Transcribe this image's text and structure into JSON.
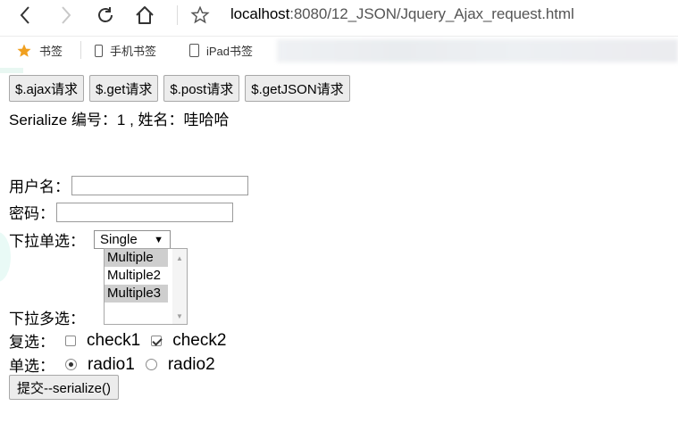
{
  "browser": {
    "url_host": "localhost",
    "url_path": ":8080/12_JSON/Jquery_Ajax_request.html",
    "bookmarks": [
      {
        "label": "书签"
      },
      {
        "label": "手机书签"
      },
      {
        "label": "iPad书签"
      }
    ],
    "colors": {
      "star": "#f0a020",
      "icon": "#333333"
    }
  },
  "page": {
    "buttons": [
      "$.ajax请求",
      "$.get请求",
      "$.post请求",
      "$.getJSON请求"
    ],
    "serialize_text": "Serialize 编号：1 , 姓名：哇哈哈",
    "form": {
      "username_label": "用户名：",
      "username_value": "",
      "password_label": "密码：",
      "password_value": "",
      "single_select_label": "下拉单选：",
      "single_select_value": "Single",
      "multi_select_label": "下拉多选：",
      "multi_options": [
        {
          "label": "Multiple",
          "selected": true
        },
        {
          "label": "Multiple2",
          "selected": false
        },
        {
          "label": "Multiple3",
          "selected": true
        }
      ],
      "checkbox_label": "复选：",
      "checkboxes": [
        {
          "label": "check1",
          "checked": false
        },
        {
          "label": "check2",
          "checked": true
        }
      ],
      "radio_label": "单选：",
      "radios": [
        {
          "label": "radio1",
          "checked": true
        },
        {
          "label": "radio2",
          "checked": false
        }
      ],
      "submit_label": "提交--serialize()"
    }
  }
}
